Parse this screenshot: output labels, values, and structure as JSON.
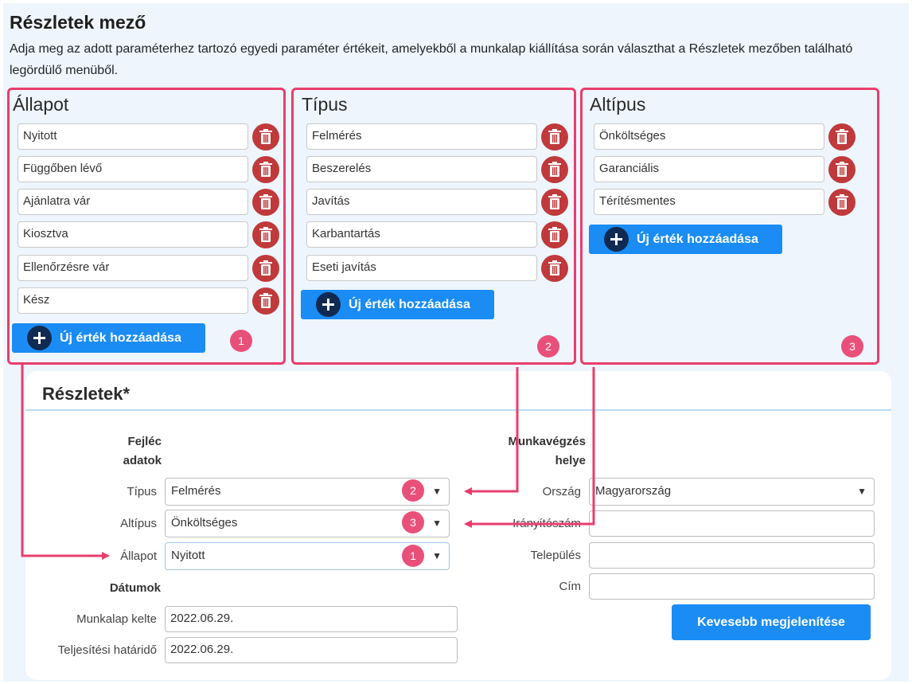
{
  "header": {
    "title": "Részletek mező",
    "description": "Adja meg az adott paraméterhez tartozó egyedi paraméter értékeit, amelyekből a munkalap kiállítása során választhat a Részletek mezőben található legördülő menüből."
  },
  "panels": [
    {
      "title": "Állapot",
      "values": [
        "Nyitott",
        "Függőben lévő",
        "Ajánlatra vár",
        "Kiosztva",
        "Ellenőrzésre vár",
        "Kész"
      ],
      "add_label": "Új érték hozzáadása",
      "badge": "1"
    },
    {
      "title": "Típus",
      "values": [
        "Felmérés",
        "Beszerelés",
        "Javítás",
        "Karbantartás",
        "Eseti javítás"
      ],
      "add_label": "Új érték hozzáadása",
      "badge": "2"
    },
    {
      "title": "Altípus",
      "values": [
        "Önköltséges",
        "Garanciális",
        "Térítésmentes"
      ],
      "add_label": "Új érték hozzáadása",
      "badge": "3"
    }
  ],
  "details": {
    "title": "Részletek*",
    "left_section_title": "Fejléc adatok",
    "right_section_title": "Munkavégzés helye",
    "tipus_label": "Típus",
    "tipus_value": "Felmérés",
    "tipus_badge": "2",
    "altipus_label": "Altípus",
    "altipus_value": "Önköltséges",
    "altipus_badge": "3",
    "allapot_label": "Állapot",
    "allapot_value": "Nyitott",
    "allapot_badge": "1",
    "dates_title": "Dátumok",
    "munkalap_kelte_label": "Munkalap kelte",
    "munkalap_kelte_value": "2022.06.29.",
    "teljesitesi_label": "Teljesítési határidő",
    "teljesitesi_value": "2022.06.29.",
    "orszag_label": "Ország",
    "orszag_value": "Magyarország",
    "iranyitoszam_label": "Irányítószám",
    "iranyitoszam_value": "",
    "telepules_label": "Település",
    "telepules_value": "",
    "cim_label": "Cím",
    "cim_value": "",
    "show_less_label": "Kevesebb megjelenítése"
  },
  "colors": {
    "accent": "#1a8cf4",
    "highlight": "#e83e6c",
    "delete": "#c0393b",
    "badge": "#e8507a"
  }
}
